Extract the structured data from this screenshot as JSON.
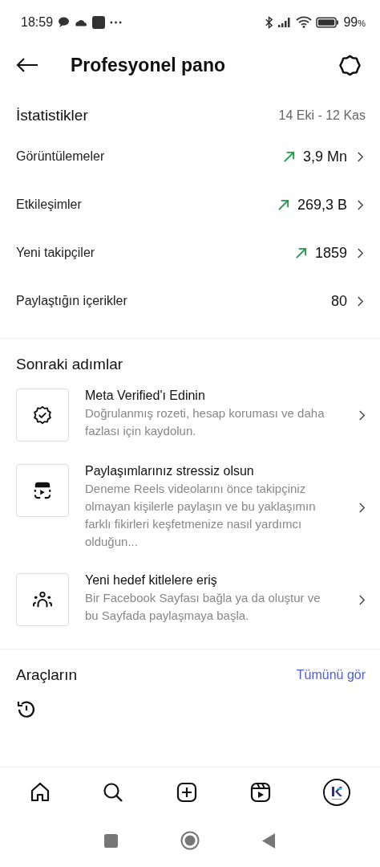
{
  "status_bar": {
    "time": "18:59",
    "battery": "99",
    "battery_unit": "%"
  },
  "header": {
    "title": "Profesyonel pano"
  },
  "stats": {
    "title": "İstatistikler",
    "date_range": "14 Eki - 12 Kas",
    "rows": [
      {
        "label": "Görüntülemeler",
        "value": "3,9 Mn",
        "trending_up": true
      },
      {
        "label": "Etkileşimler",
        "value": "269,3 B",
        "trending_up": true
      },
      {
        "label": "Yeni takipçiler",
        "value": "1859",
        "trending_up": true
      },
      {
        "label": "Paylaştığın içerikler",
        "value": "80",
        "trending_up": false
      }
    ]
  },
  "next_steps": {
    "title": "Sonraki adımlar",
    "items": [
      {
        "kind": "badge",
        "title": "Meta Verified'ı Edinin",
        "description": "Doğrulanmış rozeti, hesap koruması ve daha fazlası için kaydolun."
      },
      {
        "kind": "reels",
        "title": "Paylaşımlarınız stressiz olsun",
        "description": "Deneme Reels videolarını önce takipçiniz olmayan kişilerle paylaşın ve bu yaklaşımın farklı fikirleri keşfetmenize nasıl yardımcı olduğun..."
      },
      {
        "kind": "people",
        "title": "Yeni hedef kitlelere eriş",
        "description": "Bir Facebook Sayfası bağla ya da oluştur ve bu Sayfada paylaşmaya başla."
      }
    ]
  },
  "tools": {
    "title": "Araçların",
    "see_all": "Tümünü gör"
  },
  "bottom_nav": [
    {
      "kind": "home",
      "selected": false
    },
    {
      "kind": "search",
      "selected": false
    },
    {
      "kind": "create",
      "selected": false
    },
    {
      "kind": "reels",
      "selected": false
    },
    {
      "kind": "profile",
      "selected": true
    }
  ]
}
